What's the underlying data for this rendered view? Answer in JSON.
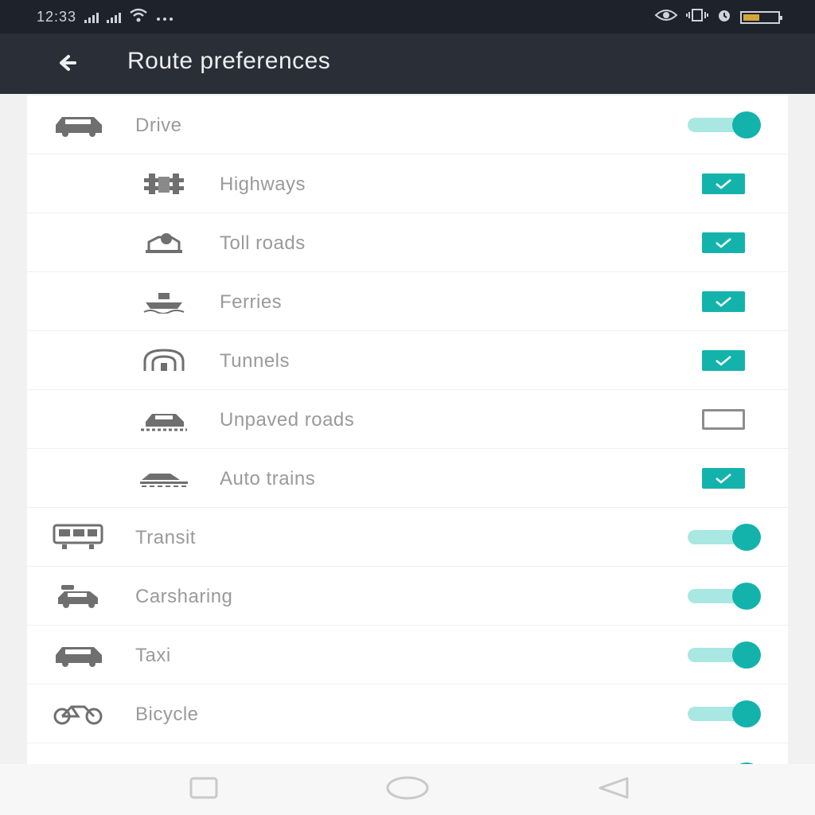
{
  "status_bar": {
    "time": "12:33",
    "icons": [
      "signal-icon",
      "signal-icon",
      "wifi-icon",
      "more-icon",
      "eye-icon",
      "vibrate-icon",
      "alarm-icon",
      "battery-icon"
    ],
    "battery_color": "#d6a53a"
  },
  "app_bar": {
    "back_icon": "back-arrow-icon",
    "title": "Route preferences"
  },
  "colors": {
    "accent": "#13b3ac",
    "accent_light": "#a8e7e2",
    "app_bar_bg": "#2a2e36",
    "status_bar_bg": "#1e222a"
  },
  "preferences": [
    {
      "label": "Drive",
      "icon": "car-icon",
      "control": "toggle",
      "on": true
    },
    {
      "label": "Highways",
      "icon": "highway-icon",
      "control": "checkbox",
      "checked": true
    },
    {
      "label": "Toll roads",
      "icon": "toll-road-icon",
      "control": "checkbox",
      "checked": true
    },
    {
      "label": "Ferries",
      "icon": "ferry-icon",
      "control": "checkbox",
      "checked": true
    },
    {
      "label": "Tunnels",
      "icon": "tunnel-icon",
      "control": "checkbox",
      "checked": true
    },
    {
      "label": "Unpaved roads",
      "icon": "unpaved-road-icon",
      "control": "checkbox",
      "checked": false
    },
    {
      "label": "Auto trains",
      "icon": "auto-train-icon",
      "control": "checkbox",
      "checked": true
    },
    {
      "label": "Transit",
      "icon": "transit-icon",
      "control": "toggle",
      "on": true
    },
    {
      "label": "Carsharing",
      "icon": "carsharing-icon",
      "control": "toggle",
      "on": true
    },
    {
      "label": "Taxi",
      "icon": "taxi-icon",
      "control": "toggle",
      "on": true
    },
    {
      "label": "Bicycle",
      "icon": "bicycle-icon",
      "control": "toggle",
      "on": true
    }
  ],
  "nav_bar": {
    "buttons": [
      "recent-apps-icon",
      "home-icon",
      "back-icon"
    ]
  }
}
